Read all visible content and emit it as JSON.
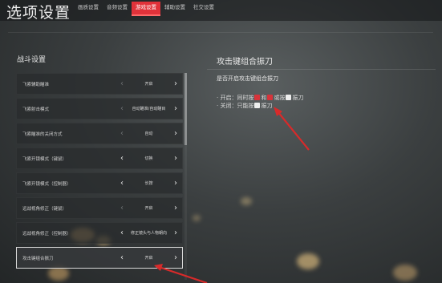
{
  "header": {
    "title": "选项设置",
    "tabs": [
      {
        "label": "画质设置",
        "active": false
      },
      {
        "label": "音频设置",
        "active": false
      },
      {
        "label": "游戏设置",
        "active": true
      },
      {
        "label": "辅助设置",
        "active": false
      },
      {
        "label": "社交设置",
        "active": false
      }
    ]
  },
  "left_panel": {
    "section_title": "战斗设置",
    "rows": [
      {
        "label": "飞索辅助瞄准",
        "value": "开启",
        "left_arrow_active": false,
        "right_arrow_active": true
      },
      {
        "label": "飞索射击模式",
        "value": "自动瞄准/自动瞄目",
        "left_arrow_active": false,
        "right_arrow_active": true
      },
      {
        "label": "飞索瞄准的关闭方式",
        "value": "自动",
        "left_arrow_active": false,
        "right_arrow_active": true
      },
      {
        "label": "飞索开镜模式（键鼠）",
        "value": "切换",
        "left_arrow_active": true,
        "right_arrow_active": true
      },
      {
        "label": "飞索开镜模式（控制器）",
        "value": "长按",
        "left_arrow_active": true,
        "right_arrow_active": true
      },
      {
        "label": "远战视角修正（键鼠）",
        "value": "开启",
        "left_arrow_active": false,
        "right_arrow_active": true
      },
      {
        "label": "远战视角修正（控制器）",
        "value": "修正镜头与人物朝向",
        "left_arrow_active": true,
        "right_arrow_active": true
      },
      {
        "label": "攻击键组合振刀",
        "value": "开启",
        "left_arrow_active": true,
        "right_arrow_active": true,
        "selected": true
      }
    ]
  },
  "right_panel": {
    "title": "攻击键组合振刀",
    "question": "是否开启攻击键组合振刀",
    "option_on_prefix": "· 开启：同时按",
    "option_on_mid1": "和",
    "option_on_mid2": "或按",
    "option_on_suffix": "振刀",
    "option_off_prefix": "· 关闭：只能按",
    "option_off_suffix": "振刀"
  },
  "colors": {
    "accent": "#e0323a",
    "annotation_arrow": "#d82a2a"
  }
}
